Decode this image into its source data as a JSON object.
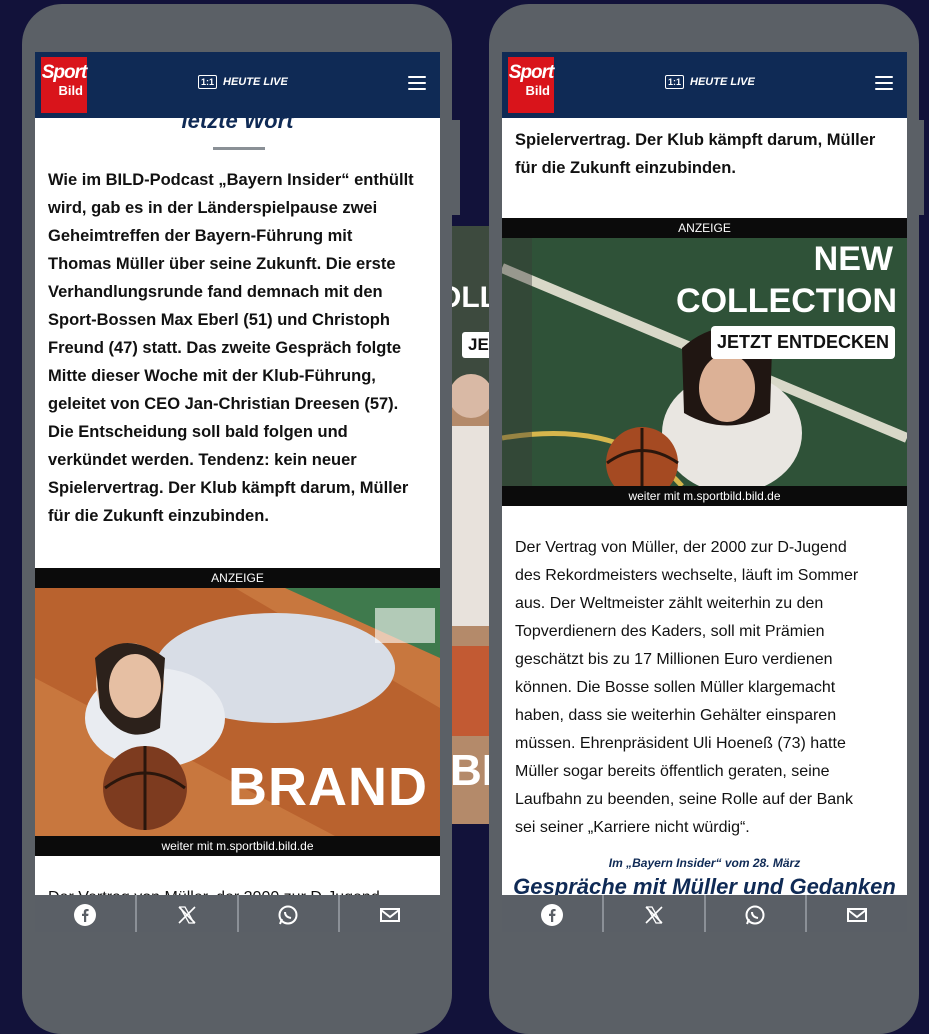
{
  "header": {
    "logo_line1": "Sport",
    "logo_line2": "Bild",
    "live_badge": "1:1",
    "live_label": "HEUTE LIVE"
  },
  "left": {
    "section_title_partial": "letzte Wort",
    "paragraph_lines": [
      "Wie im BILD-Podcast „Bayern Insider“ enthüllt",
      "wird, gab es in der Länderspielpause zwei",
      "Geheimtreffen der Bayern-Führung mit",
      "Thomas Müller über seine Zukunft. Die erste",
      "Verhandlungsrunde fand demnach mit den",
      "Sport-Bossen Max Eberl (51) und Christoph",
      "Freund (47) statt. Das zweite Gespräch folgte",
      "Mitte dieser Woche mit der Klub-Führung,",
      "geleitet von CEO Jan-Christian Dreesen (57).",
      "Die Entscheidung soll bald folgen und",
      "verkündet werden. Tendenz: kein neuer",
      "Spielervertrag. Der Klub kämpft darum, Müller",
      "für die Zukunft einzubinden."
    ],
    "ad_label": "ANZEIGE",
    "ad_word": "BRAND",
    "ad_footer": "weiter mit m.sportbild.bild.de",
    "cut_line": "Der Vertrag von Müller, der 2000 zur D-Jugend"
  },
  "background_ad": {
    "text_fragment": "OLL",
    "button_fragment": "JE",
    "word_fragment": "BR"
  },
  "right": {
    "paragraph_top_lines": [
      "Spielervertrag. Der Klub kämpft darum, Müller",
      "für die Zukunft einzubinden."
    ],
    "ad_label": "ANZEIGE",
    "ad_title1": "NEW",
    "ad_title2": "COLLECTION",
    "ad_button": "JETZT ENTDECKEN",
    "ad_footer": "weiter mit m.sportbild.bild.de",
    "paragraph_lines": [
      "Der Vertrag von Müller, der 2000 zur D-Jugend",
      "des Rekordmeisters wechselte, läuft im Sommer",
      "aus. Der Weltmeister zählt weiterhin zu den",
      "Topverdienern des Kaders, soll mit Prämien",
      "geschätzt bis zu 17 Millionen Euro verdienen",
      "können. Die Bosse sollen Müller klargemacht",
      "haben, dass sie weiterhin Gehälter einsparen",
      "müssen. Ehrenpräsident Uli Hoeneß (73) hatte",
      "Müller sogar bereits öffentlich geraten, seine",
      "Laufbahn zu beenden, seine Rolle auf der Bank",
      "sei seiner „Karriere nicht würdig“."
    ],
    "kicker": "Im „Bayern Insider“ vom 28. März",
    "headline_partial": "Gespräche mit Müller und Gedanken"
  },
  "share_icons": [
    "facebook-icon",
    "x-icon",
    "whatsapp-icon",
    "mail-icon"
  ],
  "colors": {
    "page_bg": "#12123a",
    "phone_frame": "#5b6066",
    "header_bg": "#0f2a55",
    "logo_red": "#d9141b",
    "share_bar": "#5a5f66"
  }
}
